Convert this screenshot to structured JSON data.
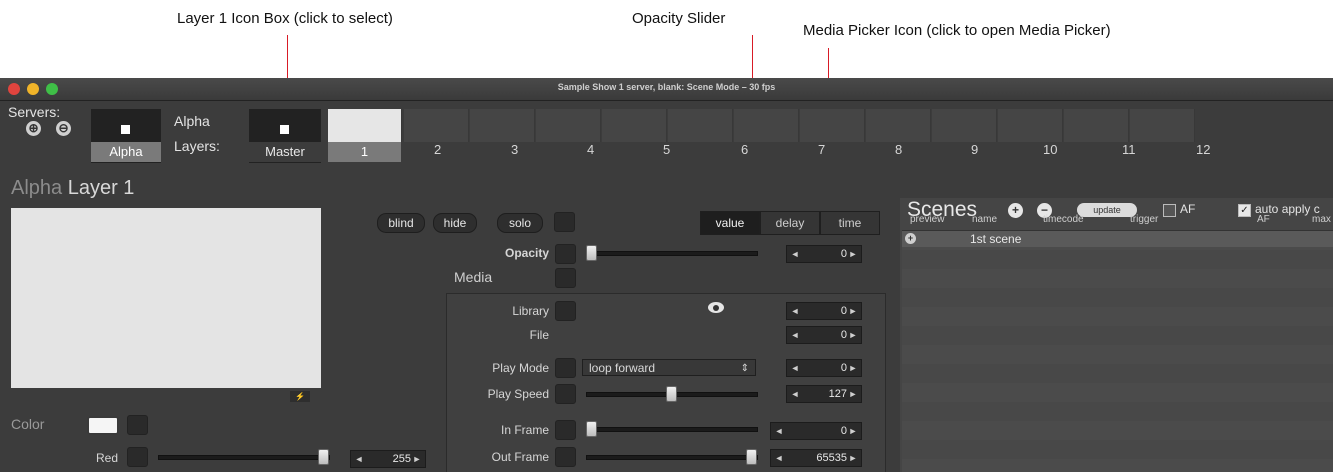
{
  "annotations": {
    "layer_icon_box": "Layer 1 Icon Box (click to select)",
    "opacity_slider": "Opacity Slider",
    "media_picker_icon": "Media Picker Icon (click to open Media Picker)"
  },
  "window": {
    "title": "Sample Show 1 server, blank: Scene Mode – 30 fps"
  },
  "servers": {
    "label": "Servers:",
    "add_icon": "⊕",
    "remove_icon": "⊖",
    "server_name": "Alpha",
    "selected_server": "Alpha"
  },
  "layers_header": {
    "name_line1": "Alpha",
    "name_line2": "Layers:",
    "master_label": "Master",
    "layer_numbers": [
      "1",
      "2",
      "3",
      "4",
      "5",
      "6",
      "7",
      "8",
      "9",
      "10",
      "11",
      "12"
    ]
  },
  "panel": {
    "title_prefix": "Alpha",
    "title_suffix": "Layer 1"
  },
  "toggles": {
    "blind": "blind",
    "hide": "hide",
    "solo": "solo"
  },
  "modes": {
    "value": "value",
    "delay": "delay",
    "time": "time",
    "selected": "value"
  },
  "params": {
    "opacity": {
      "label": "Opacity",
      "value": "0",
      "fraction": 0.0
    },
    "media_heading": "Media",
    "library": {
      "label": "Library",
      "value": "0"
    },
    "file": {
      "label": "File",
      "value": "0"
    },
    "play_mode": {
      "label": "Play Mode",
      "selected": "loop forward",
      "value": "0"
    },
    "play_speed": {
      "label": "Play Speed",
      "value": "127",
      "fraction": 0.5
    },
    "in_frame": {
      "label": "In Frame",
      "value": "0",
      "fraction": 0.0
    },
    "out_frame": {
      "label": "Out Frame",
      "value": "65535",
      "fraction": 1.0
    }
  },
  "color": {
    "label": "Color",
    "red_label": "Red",
    "red_value": "255",
    "red_fraction": 1.0
  },
  "scenes": {
    "title": "Scenes",
    "update_label": "update",
    "af_label": "AF",
    "auto_apply_label": "auto apply c",
    "auto_apply_checked": true,
    "af_checked": false,
    "columns": [
      "preview",
      "name",
      "timecode",
      "trigger",
      "AF",
      "max"
    ],
    "rows": [
      {
        "name": "1st scene"
      }
    ]
  },
  "stepper_arrows": {
    "left": "◄",
    "right": "►"
  },
  "colors": {
    "window_bg": "#3c3c3c",
    "callout_line": "#d81b26",
    "selected_tab": "#7a7a7a"
  }
}
